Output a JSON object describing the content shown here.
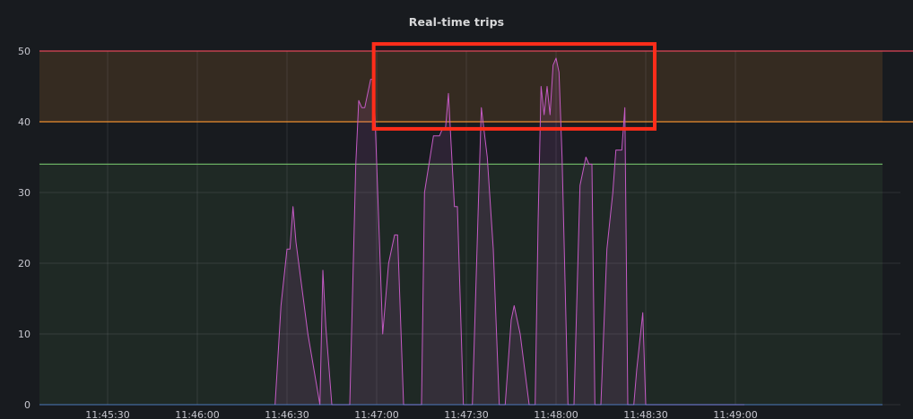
{
  "panel": {
    "title": "Real-time trips"
  },
  "chart_data": {
    "type": "area",
    "title": "Real-time trips",
    "xlabel": "",
    "ylabel": "",
    "ylim": [
      0,
      50
    ],
    "y_ticks": [
      0,
      10,
      20,
      30,
      40,
      50
    ],
    "x_range": [
      "11:45:20",
      "11:49:10"
    ],
    "x_ticks": [
      "11:45:30",
      "11:46:00",
      "11:46:30",
      "11:47:00",
      "11:47:30",
      "11:48:00",
      "11:48:30",
      "11:49:00"
    ],
    "grid": true,
    "legend": "none",
    "thresholds": [
      {
        "from": 0,
        "to": 34,
        "color": "#73bf69"
      },
      {
        "from": 40,
        "to": 50,
        "color": "#ff9830"
      }
    ],
    "threshold_lines": [
      {
        "value": 34,
        "color": "#73bf69"
      },
      {
        "value": 40,
        "color": "#ff9830"
      },
      {
        "value": 50,
        "color": "#f2495c"
      }
    ],
    "annotation_box": {
      "x_from": "11:46:59",
      "x_to": "11:48:33",
      "y_from": 39,
      "y_to": 51,
      "color": "#ff2d1a"
    },
    "series": [
      {
        "color": "#c45ac4",
        "x": [
          "11:46:26",
          "11:46:28",
          "11:46:30",
          "11:46:31",
          "11:46:32",
          "11:46:33",
          "11:46:37",
          "11:46:41",
          "11:46:42",
          "11:46:43",
          "11:46:45",
          "11:46:46",
          "11:46:51",
          "11:46:53",
          "11:46:54",
          "11:46:55",
          "11:46:56",
          "11:46:58",
          "11:46:59",
          "11:47:02",
          "11:47:03",
          "11:47:04",
          "11:47:06",
          "11:47:07",
          "11:47:09",
          "11:47:10",
          "11:47:11",
          "11:47:14",
          "11:47:15",
          "11:47:16",
          "11:47:19",
          "11:47:20",
          "11:47:21",
          "11:47:22",
          "11:47:23",
          "11:47:24",
          "11:47:26",
          "11:47:27",
          "11:47:29",
          "11:47:31",
          "11:47:32",
          "11:47:34",
          "11:47:35",
          "11:47:37",
          "11:47:39",
          "11:47:41",
          "11:47:42",
          "11:47:43",
          "11:47:45",
          "11:47:46",
          "11:47:48",
          "11:47:51",
          "11:47:52",
          "11:47:53",
          "11:47:54",
          "11:47:55",
          "11:47:56",
          "11:47:57",
          "11:47:58",
          "11:47:59",
          "11:48:00",
          "11:48:01",
          "11:48:02",
          "11:48:04",
          "11:48:06",
          "11:48:08",
          "11:48:10",
          "11:48:11",
          "11:48:12",
          "11:48:13",
          "11:48:14",
          "11:48:15",
          "11:48:17",
          "11:48:19",
          "11:48:20",
          "11:48:21",
          "11:48:22",
          "11:48:23",
          "11:48:24",
          "11:48:25",
          "11:48:26",
          "11:48:27",
          "11:48:29",
          "11:48:30",
          "11:48:31",
          "11:48:33",
          "11:48:34",
          "11:48:36",
          "11:48:38",
          "11:49:03"
        ],
        "values": [
          0,
          14,
          22,
          22,
          28,
          23,
          10,
          0,
          19,
          11,
          0,
          0,
          0,
          34,
          43,
          42,
          42,
          46,
          46,
          10,
          15,
          20,
          24,
          24,
          0,
          0,
          0,
          0,
          0,
          30,
          38,
          38,
          38,
          39,
          39,
          44,
          28,
          28,
          0,
          0,
          0,
          28,
          42,
          35,
          22,
          0,
          0,
          0,
          12,
          14,
          10,
          0,
          0,
          0,
          26,
          45,
          41,
          45,
          41,
          48,
          49,
          47,
          35,
          0,
          0,
          31,
          35,
          34,
          34,
          0,
          0,
          0,
          22,
          30,
          36,
          36,
          36,
          42,
          0,
          0,
          0,
          5,
          13,
          0,
          0,
          0,
          0,
          0,
          0,
          0
        ]
      }
    ]
  }
}
